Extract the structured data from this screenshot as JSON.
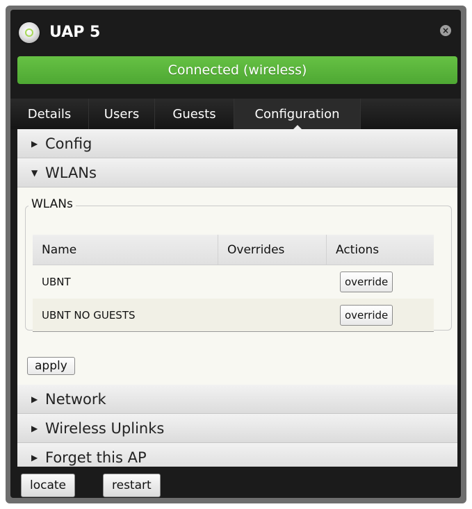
{
  "window": {
    "title": "UAP 5",
    "close_icon": "close-icon",
    "device_icon": "access-point-icon"
  },
  "status": {
    "text": "Connected (wireless)",
    "color": "#5cb83d"
  },
  "tabs": [
    {
      "label": "Details"
    },
    {
      "label": "Users"
    },
    {
      "label": "Guests"
    },
    {
      "label": "Configuration",
      "active": true
    }
  ],
  "sections": {
    "config": {
      "label": "Config",
      "expanded": false
    },
    "wlans": {
      "label": "WLANs",
      "expanded": true
    },
    "network": {
      "label": "Network",
      "expanded": false
    },
    "wireless_uplinks": {
      "label": "Wireless Uplinks",
      "expanded": false
    },
    "forget_ap": {
      "label": "Forget this AP",
      "expanded": false
    }
  },
  "wlans_box": {
    "legend": "WLANs",
    "columns": [
      "Name",
      "Overrides",
      "Actions"
    ],
    "rows": [
      {
        "name": "UBNT",
        "overrides": "",
        "action": "override"
      },
      {
        "name": "UBNT NO GUESTS",
        "overrides": "",
        "action": "override"
      }
    ],
    "apply_label": "apply"
  },
  "footer": {
    "locate_label": "locate",
    "restart_label": "restart"
  }
}
